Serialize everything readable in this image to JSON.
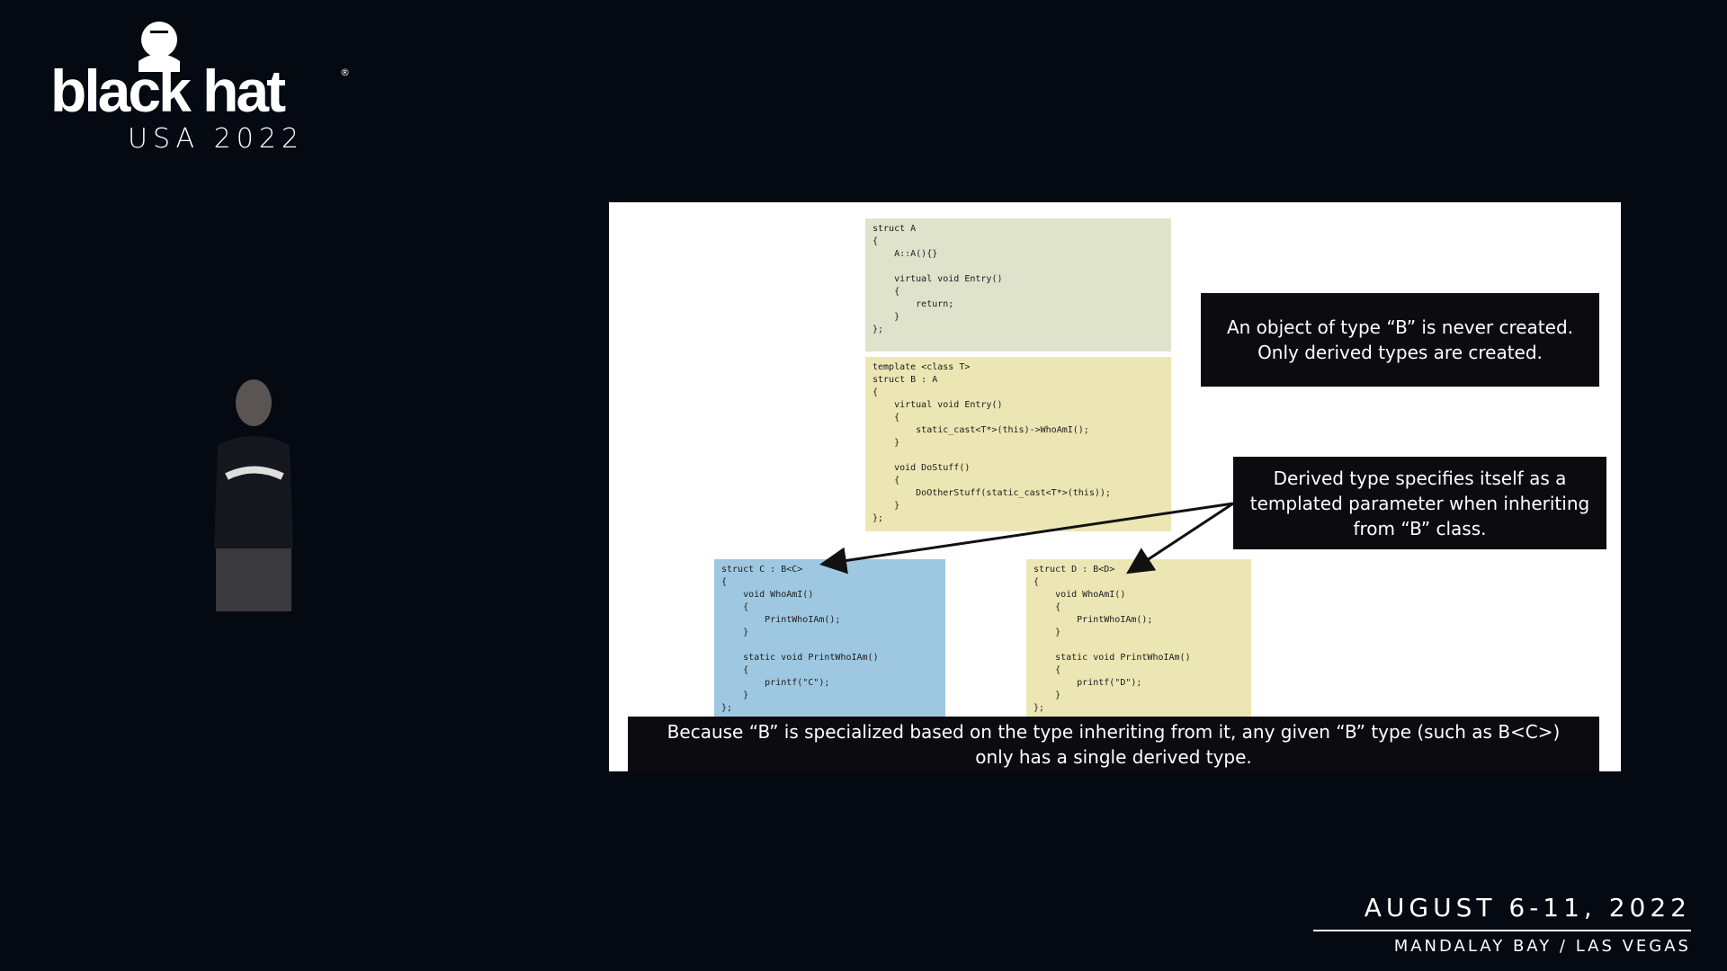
{
  "branding": {
    "logo_text": "black hat",
    "logo_reg_mark": "®",
    "logo_subtitle": "USA 2022",
    "dates": "AUGUST 6-11, 2022",
    "venue": "MANDALAY BAY / LAS VEGAS"
  },
  "slide": {
    "code_a": "struct A\n{\n    A::A(){}\n\n    virtual void Entry()\n    {\n        return;\n    }\n};",
    "code_b": "template <class T>\nstruct B : A\n{\n    virtual void Entry()\n    {\n        static_cast<T*>(this)->WhoAmI();\n    }\n\n    void DoStuff()\n    {\n        DoOtherStuff(static_cast<T*>(this));\n    }\n};",
    "code_c": "struct C : B<C>\n{\n    void WhoAmI()\n    {\n        PrintWhoIAm();\n    }\n\n    static void PrintWhoIAm()\n    {\n        printf(\"C\");\n    }\n};",
    "code_d": "struct D : B<D>\n{\n    void WhoAmI()\n    {\n        PrintWhoIAm();\n    }\n\n    static void PrintWhoIAm()\n    {\n        printf(\"D\");\n    }\n};",
    "callout_never_created": "An object of type “B” is never created.\nOnly derived types are created.",
    "callout_templated_param": "Derived type specifies itself as a\ntemplated parameter when inheriting\nfrom “B” class.",
    "callout_single_derived": "Because “B” is specialized based on the type inheriting from it, any given “B” type (such as B<C>)\nonly has a single derived type."
  },
  "colors": {
    "background": "#050912",
    "code_a_bg": "#dfe3cc",
    "code_b_bg": "#ece6b4",
    "code_c_bg": "#9ec8e1",
    "code_d_bg": "#ece6b4",
    "callout_bg": "#0c0c10"
  }
}
